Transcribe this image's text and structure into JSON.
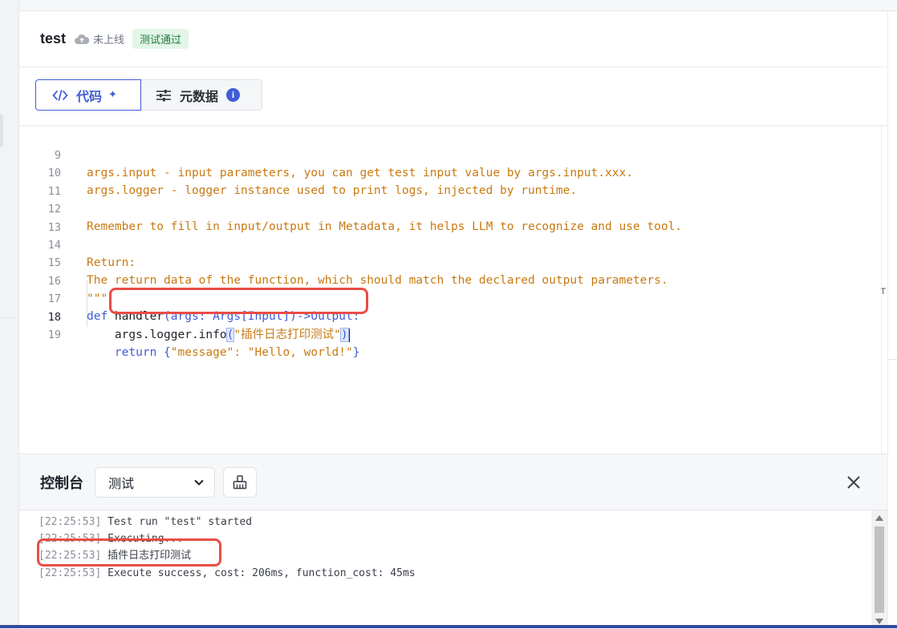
{
  "header": {
    "title": "test",
    "status": "未上线",
    "badge": "测试通过",
    "colors": {
      "badge_bg": "#e3f6e8",
      "badge_fg": "#1f7a3d"
    }
  },
  "tabs": [
    {
      "label": "代码",
      "icon": "code-icon",
      "active": true,
      "extra_icon": "sparkle-icon"
    },
    {
      "label": "元数据",
      "icon": "sliders-icon",
      "active": false,
      "extra_icon": "info-icon"
    }
  ],
  "editor": {
    "current_line": 18,
    "lines": [
      {
        "n": "9",
        "text": "args.input - input parameters, you can get test input value by args.input.xxx."
      },
      {
        "n": "10",
        "text": "args.logger - logger instance used to print logs, injected by runtime."
      },
      {
        "n": "11",
        "text": ""
      },
      {
        "n": "12",
        "text": "Remember to fill in input/output in Metadata, it helps LLM to recognize and use tool."
      },
      {
        "n": "13",
        "text": ""
      },
      {
        "n": "14",
        "text": "Return:"
      },
      {
        "n": "15",
        "text": "The return data of the function, which should match the declared output parameters."
      },
      {
        "n": "16",
        "text": "\"\"\""
      },
      {
        "n": "17",
        "def": "def",
        "plain": " handler",
        "rest": "(args: Args[Input])->Output:"
      },
      {
        "n": "18",
        "plain": "    args.logger.info",
        "open": "(",
        "str": "\"插件日志打印测试\"",
        "close": ")"
      },
      {
        "n": "19",
        "kw": "    return ",
        "brace": "{",
        "str": "\"message\": \"Hello, world!\"",
        "brace_close": "}"
      }
    ],
    "accent": "#3f5cd8",
    "string_color": "#c87a11"
  },
  "console": {
    "title": "控制台",
    "select_value": "测试",
    "logs": [
      {
        "ts": "[22:25:53]",
        "msg": " Test run \"test\" started"
      },
      {
        "ts": "[22:25:53]",
        "msg": " Executing..."
      },
      {
        "ts": "[22:25:53]",
        "msg": " 插件日志打印测试"
      },
      {
        "ts": "[22:25:53]",
        "msg": " Execute success, cost: 206ms, function_cost: 45ms"
      }
    ]
  }
}
